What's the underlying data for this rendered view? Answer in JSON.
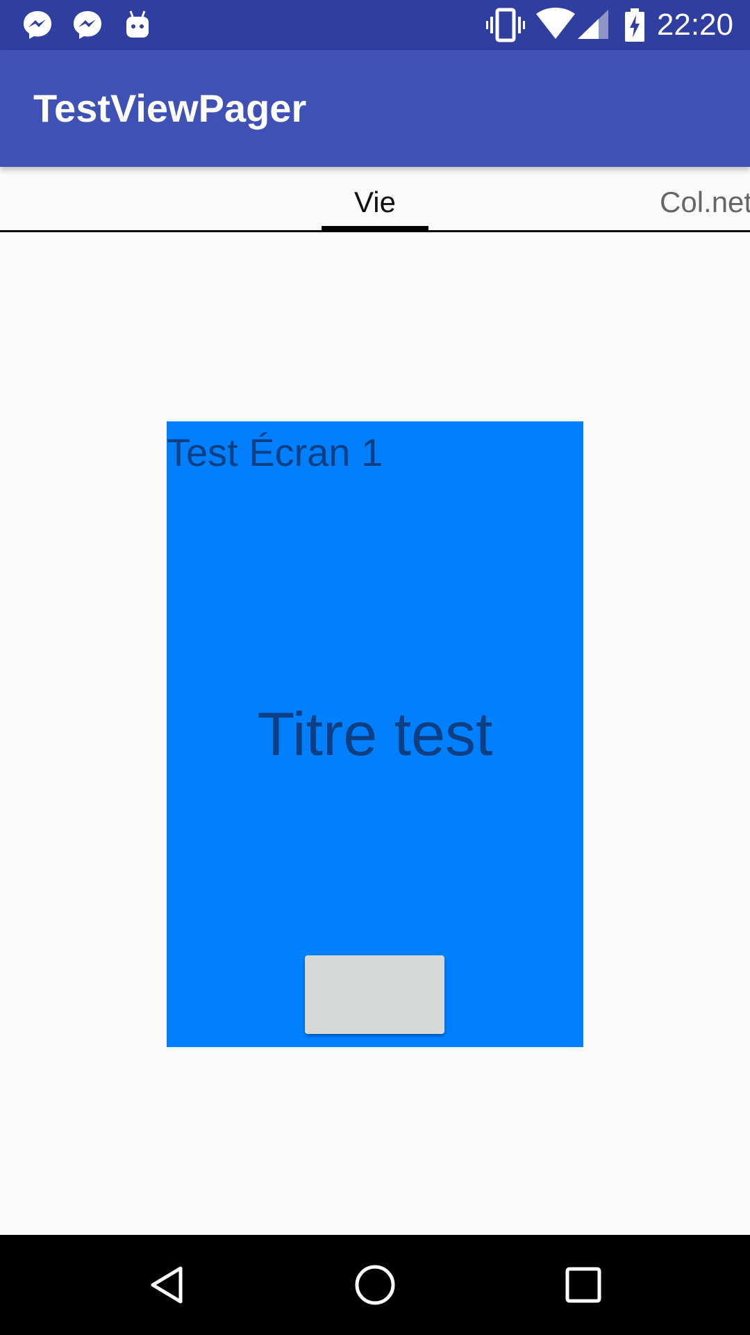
{
  "status_bar": {
    "time": "22:20",
    "icons": [
      "messenger-icon",
      "messenger-icon",
      "android-debug-icon",
      "vibrate-icon",
      "wifi-icon",
      "cell-signal-icon",
      "battery-charging-icon"
    ]
  },
  "app_bar": {
    "title": "TestViewPager"
  },
  "tabs": [
    {
      "label": "Vie",
      "selected": true
    },
    {
      "label": "Col.net",
      "selected": false
    }
  ],
  "card": {
    "small_title": "Test Écran 1",
    "big_title": "Titre test",
    "button_label": ""
  },
  "colors": {
    "status_bar": "#303f9f",
    "app_bar": "#3f51b5",
    "card_background": "#0080ff",
    "card_text": "#0d3f82",
    "button": "#d7d9d9"
  },
  "nav_bar": {
    "icons": [
      "back-icon",
      "home-icon",
      "recents-icon"
    ]
  }
}
